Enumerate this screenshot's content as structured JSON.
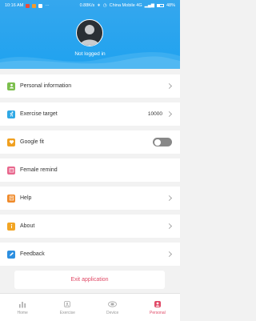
{
  "status_bar": {
    "time": "10:16 AM",
    "network_speed": "0.88K/s",
    "carrier": "China Mobile 4G",
    "battery": "48%"
  },
  "profile": {
    "login_status": "Not logged in"
  },
  "menu": {
    "personal_info": "Personal information",
    "exercise_target": "Exercise target",
    "exercise_target_value": "10000",
    "google_fit": "Google fit",
    "google_fit_enabled": false,
    "female_remind": "Female remind",
    "help": "Help",
    "about": "About",
    "feedback": "Feedback"
  },
  "exit_label": "Exit application",
  "tabs": [
    {
      "label": "Home",
      "icon": "bar-chart-icon"
    },
    {
      "label": "Exercise",
      "icon": "exercise-icon"
    },
    {
      "label": "Device",
      "icon": "band-icon"
    },
    {
      "label": "Personal",
      "icon": "person-icon"
    }
  ],
  "active_tab": "Personal",
  "colors": {
    "header": "#1fa2ef",
    "accent": "#e04a67",
    "personal_icon": "#7cbf4d",
    "exercise_icon": "#2fa8e5",
    "google_icon": "#f0a020",
    "female_icon": "#e8678d",
    "help_icon": "#ef8a2a",
    "about_icon": "#f2a524",
    "feedback_icon": "#2d8fe0"
  }
}
